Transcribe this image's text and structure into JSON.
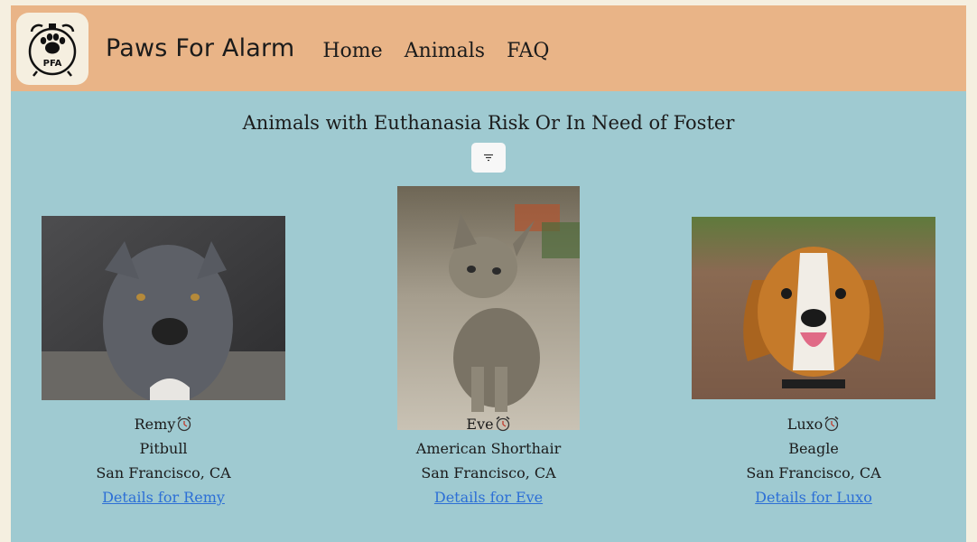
{
  "header": {
    "logo_text": "PFA",
    "brand": "Paws For Alarm",
    "nav": [
      "Home",
      "Animals",
      "FAQ"
    ]
  },
  "main": {
    "title": "Animals with Euthanasia Risk Or In Need of Foster",
    "filter_icon": "filter-icon"
  },
  "animals": [
    {
      "name": "Remy",
      "breed": "Pitbull",
      "location": "San Francisco, CA",
      "link": "Details for Remy",
      "photo": "gray-pitbull-photo"
    },
    {
      "name": "Eve",
      "breed": "American Shorthair",
      "location": "San Francisco, CA",
      "link": "Details for Eve",
      "photo": "tabby-kitten-photo"
    },
    {
      "name": "Luxo",
      "breed": "Beagle",
      "location": "San Francisco, CA",
      "link": "Details for Luxo",
      "photo": "beagle-photo"
    }
  ],
  "colors": {
    "header_bg": "#e9b487",
    "page_bg": "#9fcad1",
    "link": "#2c6fd6"
  }
}
